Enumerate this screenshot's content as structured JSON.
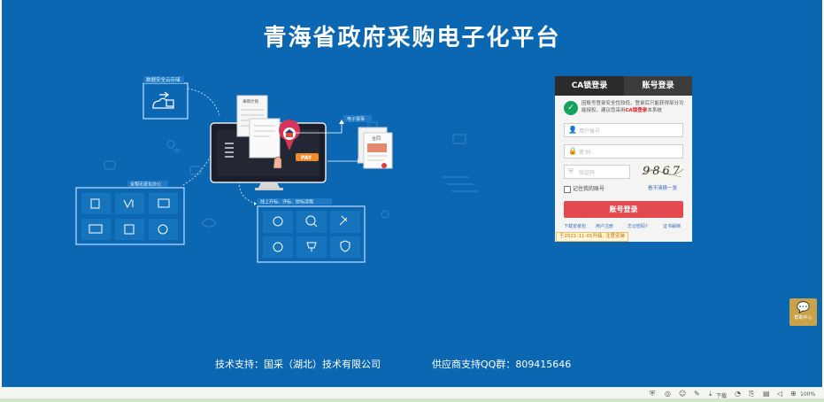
{
  "page": {
    "title": "青海省政府采购电子化平台"
  },
  "illustration": {
    "label_security": "数据安全云存储",
    "label_report": "电子报事",
    "label_plan": "采购计划",
    "label_pay": "PAY",
    "label_contract": "合同",
    "label_office": "全程无纸化办公",
    "label_bidding": "线上开标、评标、授标流程"
  },
  "login": {
    "tab_ca": "CA锁登录",
    "tab_account": "账号登录",
    "notice_prefix": "因账号登录安全性较低，",
    "notice_mid": "登录后只能获得部分功能授权。建议您采用",
    "notice_red": "CA锁登录",
    "notice_suffix": "本系统",
    "username_placeholder": "用户账号",
    "password_placeholder": "密 码",
    "captcha_placeholder": "验证码",
    "captcha_text": "9867",
    "remember_label": "记住我的账号",
    "refresh_captcha": "看不清换一张",
    "submit_label": "账号登录",
    "links": [
      "下载安装包",
      "用户注册",
      "忘记密码?",
      "证书解绑"
    ],
    "upgrade_notice": "于2021-11-01升级, 注意安装"
  },
  "service": {
    "label": "帮助中心"
  },
  "footer": {
    "support": "技术支持：国采（湖北）技术有限公司",
    "qq": "供应商支持QQ群：809415646"
  },
  "statusbar": {
    "download_label": "下载",
    "zoom": "100%"
  }
}
